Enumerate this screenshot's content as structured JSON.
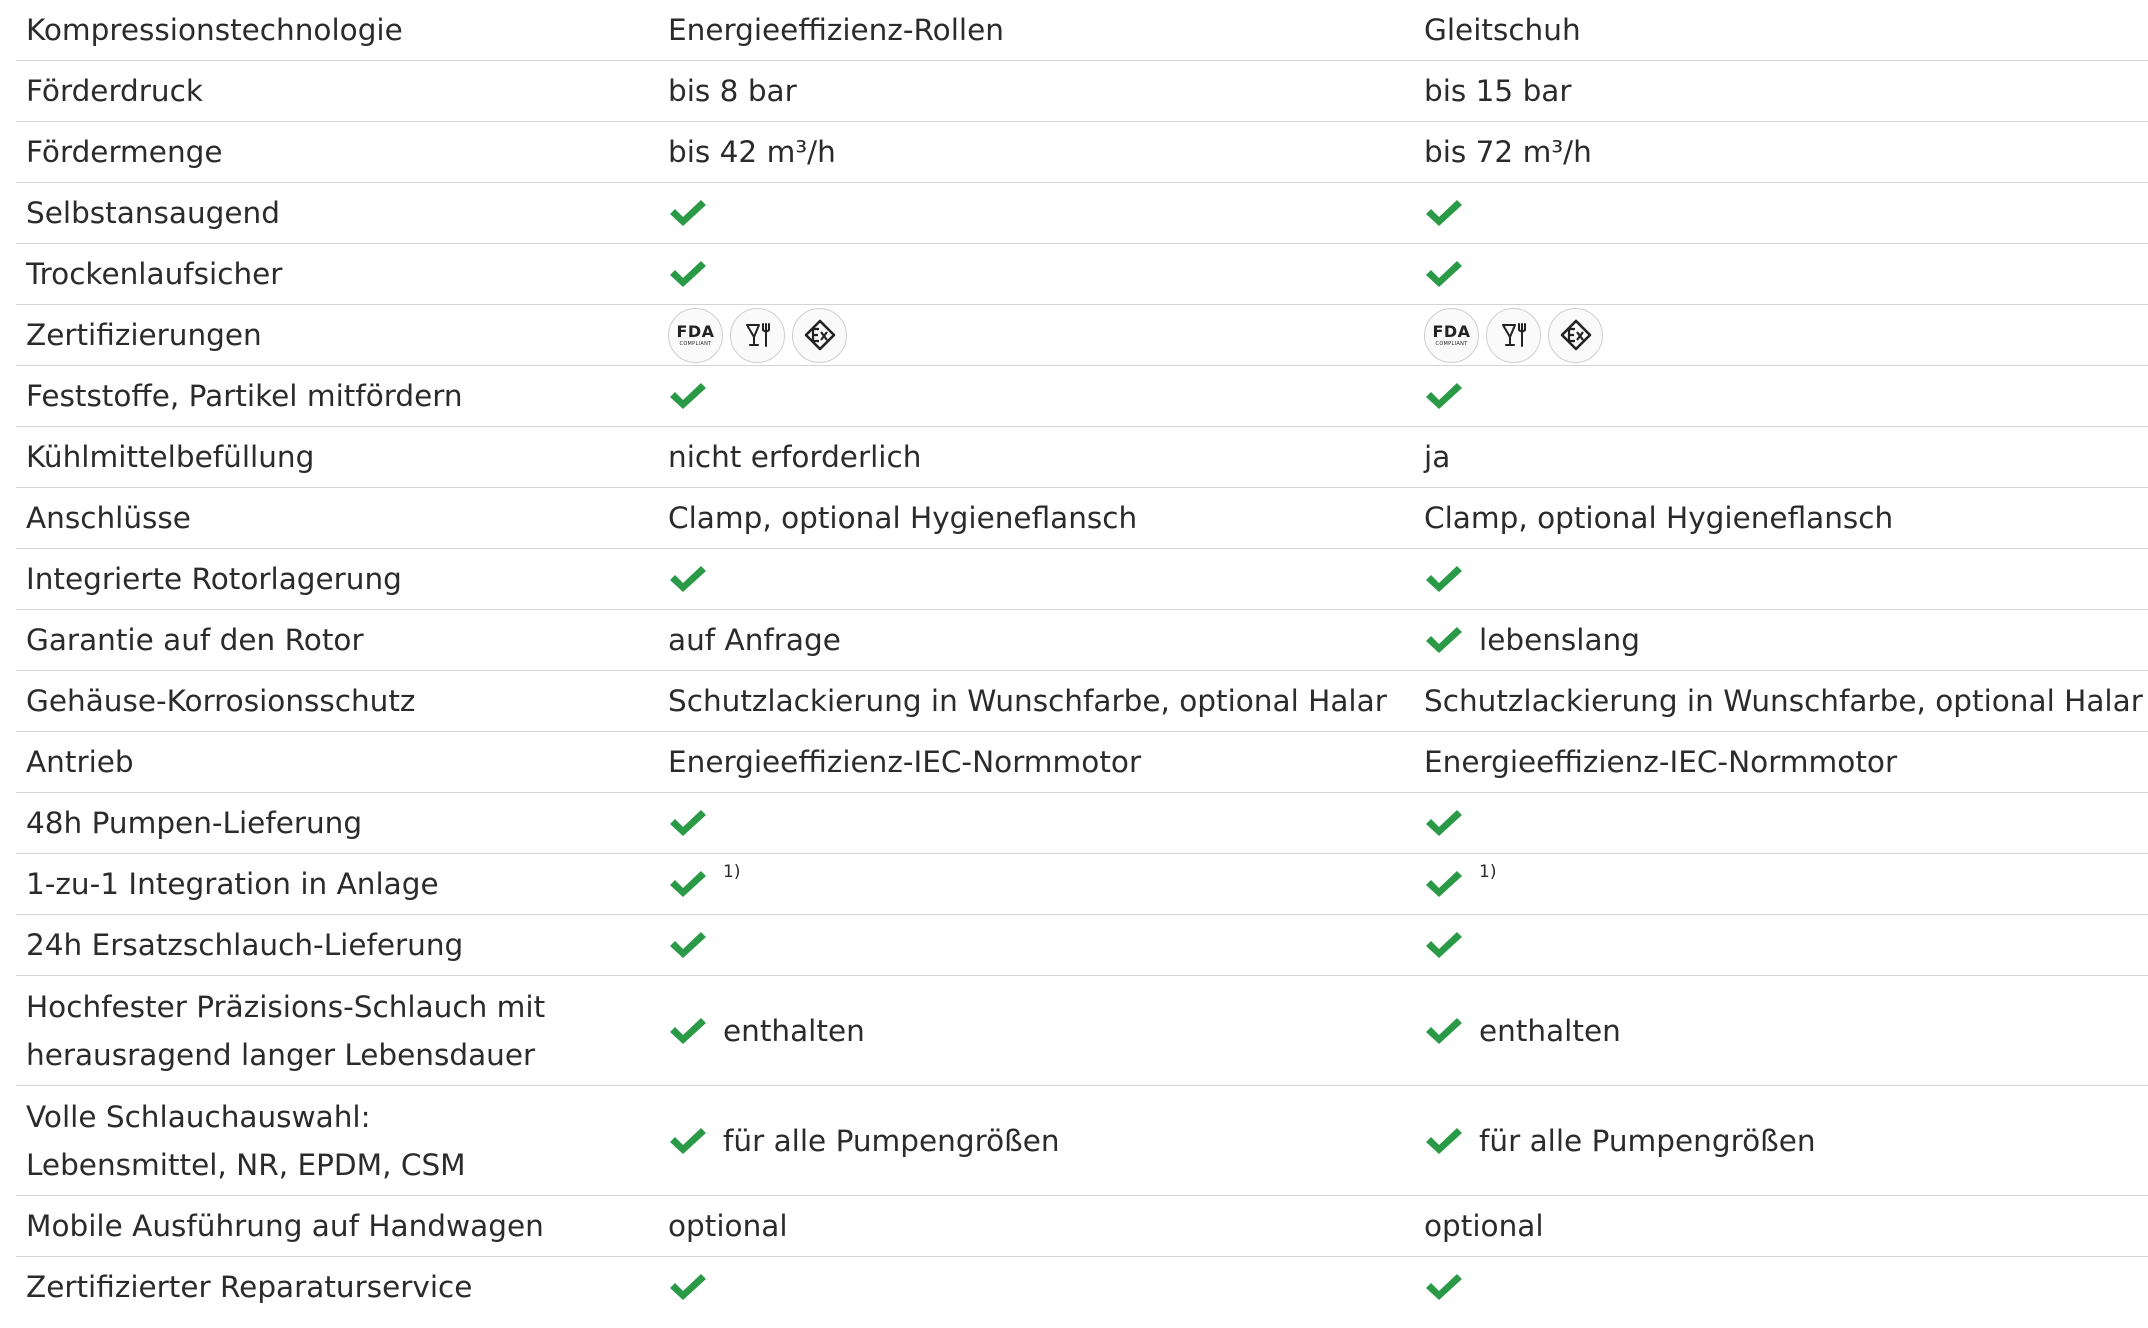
{
  "columns": [
    "Kompressionstechnologie",
    "Energieeffizienz-Rollen",
    "Gleitschuh"
  ],
  "colors": {
    "check": "#2a9a47",
    "text": "#2b2b2b",
    "divider": "#d4d4d4"
  },
  "certifications": {
    "fda_main": "FDA",
    "fda_sub": "COMPLIANT",
    "icons": [
      "fda-compliant-icon",
      "food-safe-icon",
      "ex-protection-icon"
    ]
  },
  "rows": [
    {
      "label": "Förderdruck",
      "col1": {
        "text": "bis 8 bar"
      },
      "col2": {
        "text": "bis 15 bar"
      }
    },
    {
      "label": "Fördermenge",
      "col1": {
        "text": "bis 42 m³/h"
      },
      "col2": {
        "text": "bis 72 m³/h"
      }
    },
    {
      "label": "Selbstansaugend",
      "col1": {
        "check": true
      },
      "col2": {
        "check": true
      }
    },
    {
      "label": "Trockenlaufsicher",
      "col1": {
        "check": true
      },
      "col2": {
        "check": true
      }
    },
    {
      "label": "Zertifizierungen",
      "col1": {
        "certs": true
      },
      "col2": {
        "certs": true
      }
    },
    {
      "label": "Feststoffe, Partikel mitfördern",
      "col1": {
        "check": true
      },
      "col2": {
        "check": true
      }
    },
    {
      "label": "Kühlmittelbefüllung",
      "col1": {
        "text": "nicht erforderlich"
      },
      "col2": {
        "text": "ja"
      }
    },
    {
      "label": "Anschlüsse",
      "col1": {
        "text": "Clamp, optional Hygieneflansch"
      },
      "col2": {
        "text": "Clamp, optional Hygieneflansch"
      }
    },
    {
      "label": "Integrierte Rotorlagerung",
      "col1": {
        "check": true
      },
      "col2": {
        "check": true
      }
    },
    {
      "label": "Garantie auf den Rotor",
      "col1": {
        "text": "auf Anfrage"
      },
      "col2": {
        "check": true,
        "text": "lebenslang"
      }
    },
    {
      "label": "Gehäuse-Korrosionsschutz",
      "col1": {
        "text": "Schutzlackierung in Wunschfarbe, optional Halar"
      },
      "col2": {
        "text": "Schutzlackierung in Wunschfarbe, optional Halar"
      }
    },
    {
      "label": "Antrieb",
      "col1": {
        "text": "Energieeffizienz-IEC-Normmotor"
      },
      "col2": {
        "text": "Energieeffizienz-IEC-Normmotor"
      }
    },
    {
      "label": "48h Pumpen-Lieferung",
      "col1": {
        "check": true
      },
      "col2": {
        "check": true
      }
    },
    {
      "label": "1-zu-1 Integration in Anlage",
      "col1": {
        "check": true,
        "footnote": "1)"
      },
      "col2": {
        "check": true,
        "footnote": "1)"
      }
    },
    {
      "label": "24h Ersatzschlauch-Lieferung",
      "col1": {
        "check": true
      },
      "col2": {
        "check": true
      }
    },
    {
      "label": "Hochfester Präzisions-Schlauch mit",
      "label2": "herausragend langer Lebensdauer",
      "col1": {
        "check": true,
        "text": "enthalten"
      },
      "col2": {
        "check": true,
        "text": "enthalten"
      }
    },
    {
      "label": "Volle Schlauchauswahl:",
      "label2": "Lebensmittel, NR, EPDM, CSM",
      "col1": {
        "check": true,
        "text": "für alle Pumpengrößen"
      },
      "col2": {
        "check": true,
        "text": "für alle Pumpengrößen"
      }
    },
    {
      "label": "Mobile Ausführung auf Handwagen",
      "col1": {
        "text": "optional"
      },
      "col2": {
        "text": "optional"
      }
    },
    {
      "label": "Zertifizierter Reparaturservice",
      "col1": {
        "check": true
      },
      "col2": {
        "check": true
      }
    }
  ]
}
